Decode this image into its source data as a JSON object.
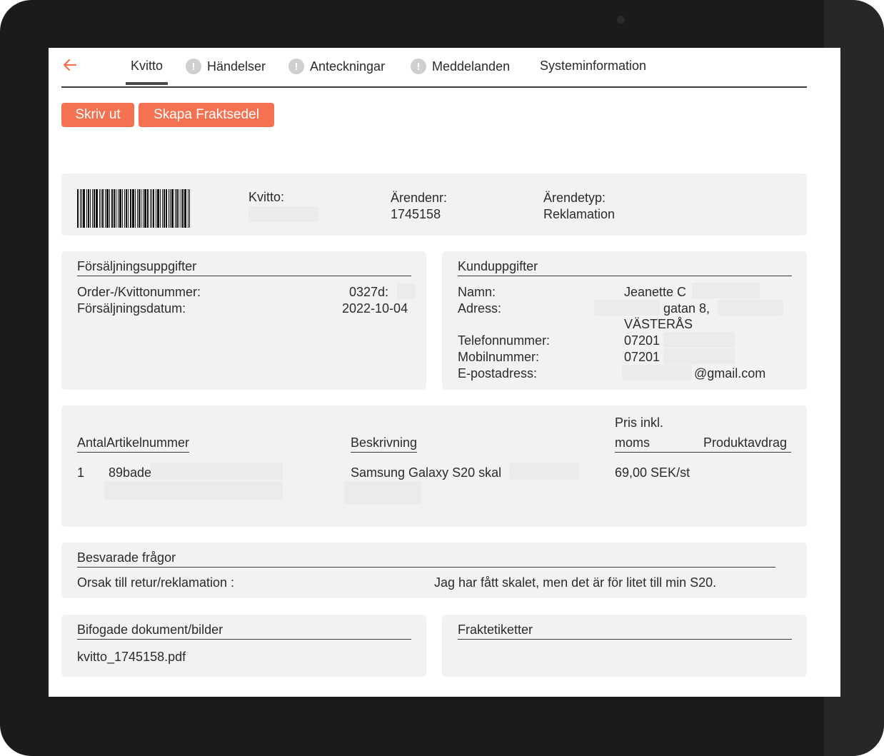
{
  "tabs": [
    {
      "label": "Kvitto",
      "alert": false,
      "active": true
    },
    {
      "label": "Händelser",
      "alert": true
    },
    {
      "label": "Anteckningar",
      "alert": true
    },
    {
      "label": "Meddelanden",
      "alert": true
    },
    {
      "label": "Systeminformation",
      "alert": false
    }
  ],
  "alert_glyph": "!",
  "buttons": {
    "print": "Skriv ut",
    "create_waybill": "Skapa Fraktsedel"
  },
  "colors": {
    "accent": "#f47151",
    "card": "#f2f2f2"
  },
  "header": {
    "receipt_label": "Kvitto:",
    "case_no_label": "Ärendenr:",
    "case_no": "1745158",
    "case_type_label": "Ärendetyp:",
    "case_type": "Reklamation"
  },
  "sales": {
    "title": "Försäljningsuppgifter",
    "order_label": "Order-/Kvittonummer:",
    "order_value": "0327d:",
    "date_label": "Försäljningsdatum:",
    "date_value": "2022-10-04"
  },
  "customer": {
    "title": "Kunduppgifter",
    "name_label": "Namn:",
    "name_value": "Jeanette C",
    "address_label": "Adress:",
    "address_line1": "gatan 8,",
    "address_line2": "VÄSTERÅS",
    "phone_label": "Telefonnummer:",
    "phone_value": "07201",
    "mobile_label": "Mobilnummer:",
    "mobile_value": "07201",
    "email_label": "E-postadress:",
    "email_value": "@gmail.com"
  },
  "items": {
    "col_qty_article": "AntalArtikelnummer",
    "col_description": "Beskrivning",
    "col_price_line1": "Pris inkl.",
    "col_price_line2": "moms",
    "col_deduction": "Produktavdrag",
    "rows": [
      {
        "qty": "1",
        "article": "89bade",
        "description": "Samsung Galaxy S20 skal",
        "price": "69,00 SEK/st"
      }
    ]
  },
  "questions": {
    "title": "Besvarade frågor",
    "reason_label": "Orsak till retur/reklamation :",
    "reason_answer": "Jag har fått skalet, men det är för litet till min S20."
  },
  "attachments": {
    "title": "Bifogade dokument/bilder",
    "file": "kvitto_1745158.pdf"
  },
  "shipping": {
    "title": "Fraktetiketter"
  }
}
